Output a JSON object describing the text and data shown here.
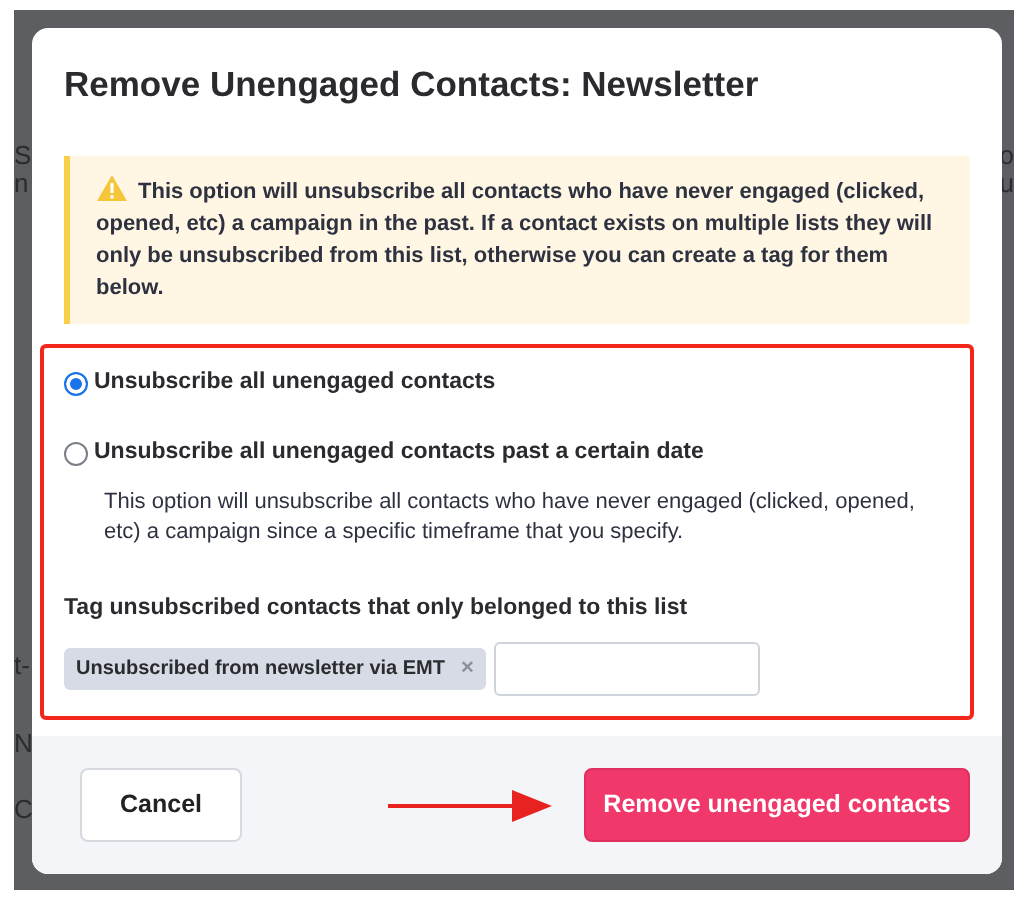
{
  "background": {
    "fragments": [
      "S",
      "n",
      "t-",
      "N",
      "C"
    ],
    "right_fragments": [
      "o",
      "u"
    ]
  },
  "modal": {
    "title": "Remove Unengaged Contacts: Newsletter",
    "alert": {
      "text": "This option will unsubscribe all contacts who have never engaged (clicked, opened, etc) a campaign in the past. If a contact exists on multiple lists they will only be unsubscribed from this list, otherwise you can create a tag for them below."
    },
    "options": [
      {
        "label": "Unsubscribe all unengaged contacts",
        "selected": true
      },
      {
        "label": "Unsubscribe all unengaged contacts past a certain date",
        "selected": false,
        "description": "This option will unsubscribe all contacts who have never engaged (clicked, opened, etc) a campaign since a specific timeframe that you specify."
      }
    ],
    "tag_label": "Tag unsubscribed contacts that only belonged to this list",
    "tags": [
      {
        "label": "Unsubscribed from newsletter via EMT",
        "remove": "×"
      }
    ],
    "buttons": [
      {
        "label": "Cancel",
        "kind": "secondary"
      },
      {
        "label": "Remove unengaged contacts",
        "kind": "danger"
      }
    ]
  }
}
